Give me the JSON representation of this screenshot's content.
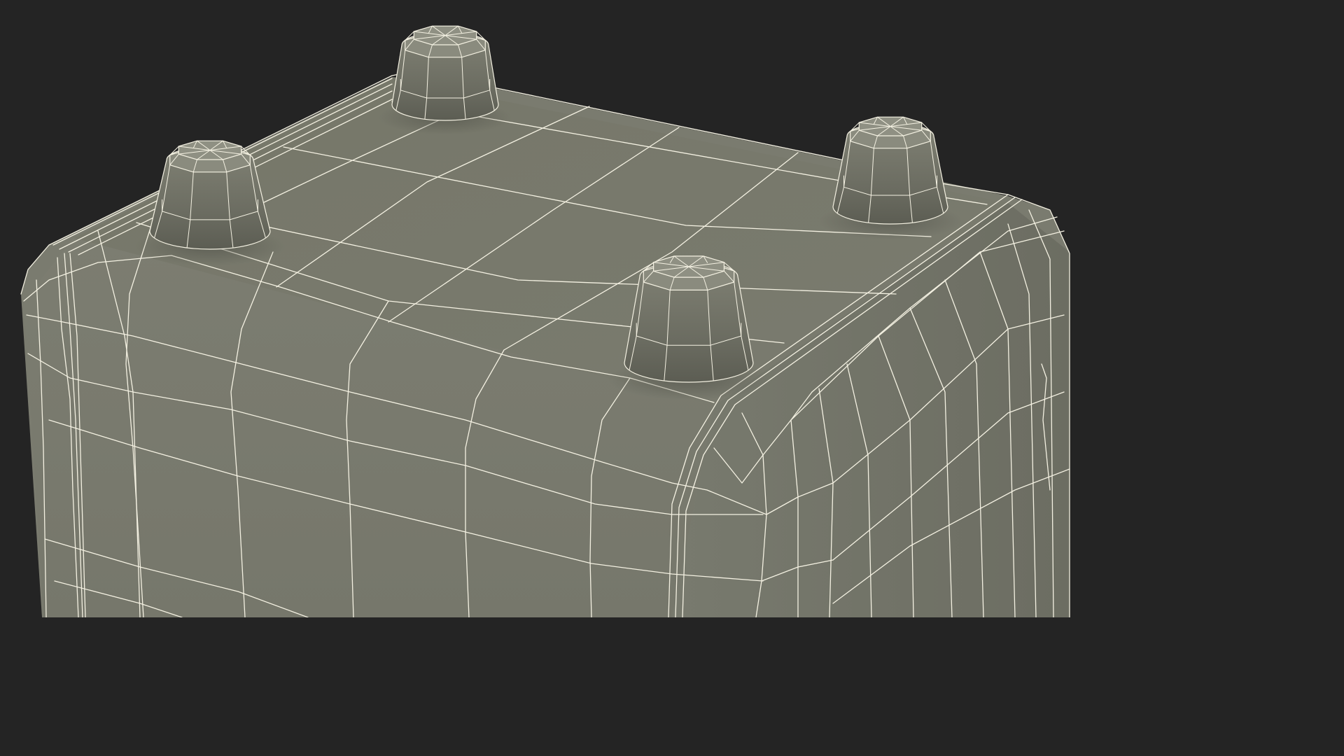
{
  "scene": {
    "background_color": "#242424",
    "surface_color": "#7a7b6f",
    "surface_shadow_color": "#5f6056",
    "wire_color": "#f4f1e2",
    "feet_count": 4
  }
}
